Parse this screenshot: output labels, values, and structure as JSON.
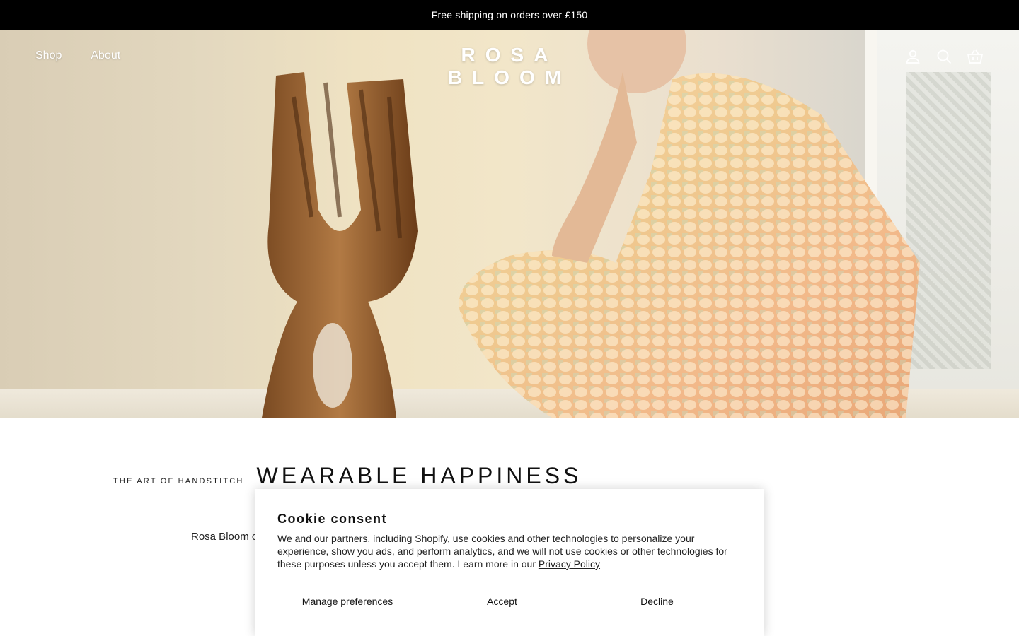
{
  "announcement": {
    "text": "Free shipping on orders over £150"
  },
  "header": {
    "nav": [
      {
        "label": "Shop"
      },
      {
        "label": "About"
      }
    ],
    "logo": "ROSA BLOOM",
    "icons": [
      "account-icon",
      "search-icon",
      "cart-icon"
    ]
  },
  "hero": {
    "description_icons": [
      "wooden-sculpture",
      "model-in-sequin-jumpsuit"
    ]
  },
  "intro": {
    "eyebrow": "THE ART OF HANDSTITCH",
    "headline": "WEARABLE HAPPINESS",
    "body_visible": "Rosa Bloom co"
  },
  "cookie": {
    "title": "Cookie consent",
    "text": "We and our partners, including Shopify, use cookies and other technologies to personalize your experience, show you ads, and perform analytics, and we will not use cookies or other technologies for these purposes unless you accept them. Learn more in our ",
    "link": "Privacy Policy",
    "manage": "Manage preferences",
    "accept": "Accept",
    "decline": "Decline"
  }
}
